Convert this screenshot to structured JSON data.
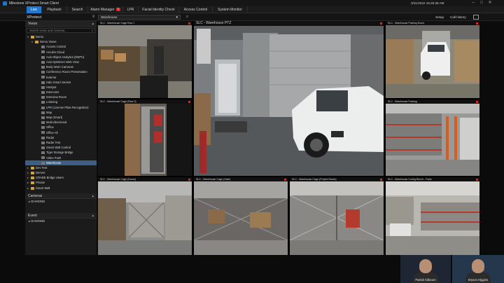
{
  "titlebar": {
    "app_title": "Milestone XProtect Smart Client",
    "datetime": "3/31/2022 15:25:35 AM"
  },
  "tabs": [
    {
      "label": "Live",
      "active": true
    },
    {
      "label": "Playback",
      "active": false
    },
    {
      "label": "Search",
      "active": false
    },
    {
      "label": "Alarm Manager",
      "active": false,
      "badge": "3"
    },
    {
      "label": "LPR",
      "active": false
    },
    {
      "label": "Facial Identity Check",
      "active": false
    },
    {
      "label": "Access Control",
      "active": false
    },
    {
      "label": "System Monitor",
      "active": false
    }
  ],
  "toolbar": {
    "brand": "XProtect",
    "view_selector": "Warehouse",
    "setup_label": "Setup",
    "call_history_label": "Call history"
  },
  "sidebar": {
    "views_header": "Views",
    "search_placeholder": "Search views and cameras...",
    "tree": [
      {
        "label": "Demo",
        "level": 0,
        "caret": "▾"
      },
      {
        "label": "Demo Views",
        "level": 1,
        "caret": "▾"
      },
      {
        "label": "Access Control",
        "level": 2
      },
      {
        "label": "Arcules Cloud",
        "level": 2
      },
      {
        "label": "Axis Object Analytics (DEPU)",
        "level": 2
      },
      {
        "label": "Axis Optimizer Web View",
        "level": 2
      },
      {
        "label": "Body Worn Cameras",
        "level": 2
      },
      {
        "label": "Conference Room Presentation",
        "level": 2
      },
      {
        "label": "Exterior",
        "level": 2
      },
      {
        "label": "Halo Smart Sensor",
        "level": 2
      },
      {
        "label": "Hotspot",
        "level": 2
      },
      {
        "label": "Intercoms",
        "level": 2
      },
      {
        "label": "Interview Room",
        "level": 2
      },
      {
        "label": "Loitering",
        "level": 2
      },
      {
        "label": "LPR (License Plate Recognition)",
        "level": 2
      },
      {
        "label": "Map",
        "level": 2
      },
      {
        "label": "Map (Smart)",
        "level": 2
      },
      {
        "label": "Multi-directional",
        "level": 2
      },
      {
        "label": "Office",
        "level": 2
      },
      {
        "label": "Office All",
        "level": 2
      },
      {
        "label": "Radar",
        "level": 2
      },
      {
        "label": "Radar Test",
        "level": 2
      },
      {
        "label": "Smart Wall Control",
        "level": 2
      },
      {
        "label": "Tiger Storage Bridge",
        "level": 2
      },
      {
        "label": "Video Push",
        "level": 2
      },
      {
        "label": "Warehouse",
        "level": 2,
        "selected": true
      },
      {
        "label": "Dev Test",
        "level": 0,
        "caret": "▸"
      },
      {
        "label": "Denver",
        "level": 0,
        "caret": "▸"
      },
      {
        "label": "CRABE Bridge Users",
        "level": 0,
        "caret": "▸"
      },
      {
        "label": "Private",
        "level": 0,
        "caret": "▸"
      },
      {
        "label": "Smart Wall",
        "level": 0,
        "caret": "▸"
      }
    ],
    "cameras_header": "Cameras",
    "cameras_item": "DIAMOND",
    "event_header": "Event",
    "event_item": "DIAMOND"
  },
  "tiles": [
    {
      "title": "SLC - Warehouse Cage Row 1",
      "scene": "shelves"
    },
    {
      "title": "SLC - Warehouse PTZ",
      "scene": "ptz",
      "big": true
    },
    {
      "title": "SLC - Warehouse Parking Doors",
      "scene": "parking"
    },
    {
      "title": "SLC - Warehouse Cage (Row 3)",
      "scene": "aisle"
    },
    {
      "title": "SLC - Warehouse Parking",
      "scene": "racks"
    },
    {
      "title": "SLC - Warehouse Cage (Doors)",
      "scene": "cage"
    },
    {
      "title": "SLC - Warehouse Cage (Gate)",
      "scene": "cage2"
    },
    {
      "title": "SLC - Warehouse Cage (Project Racks)",
      "scene": "fence"
    },
    {
      "title": "SLC - Warehouse Config Bench - Parts",
      "scene": "bench"
    }
  ],
  "participants": [
    {
      "name": "Patrick Kilbourn"
    },
    {
      "name": "Bryson Higgins"
    }
  ]
}
